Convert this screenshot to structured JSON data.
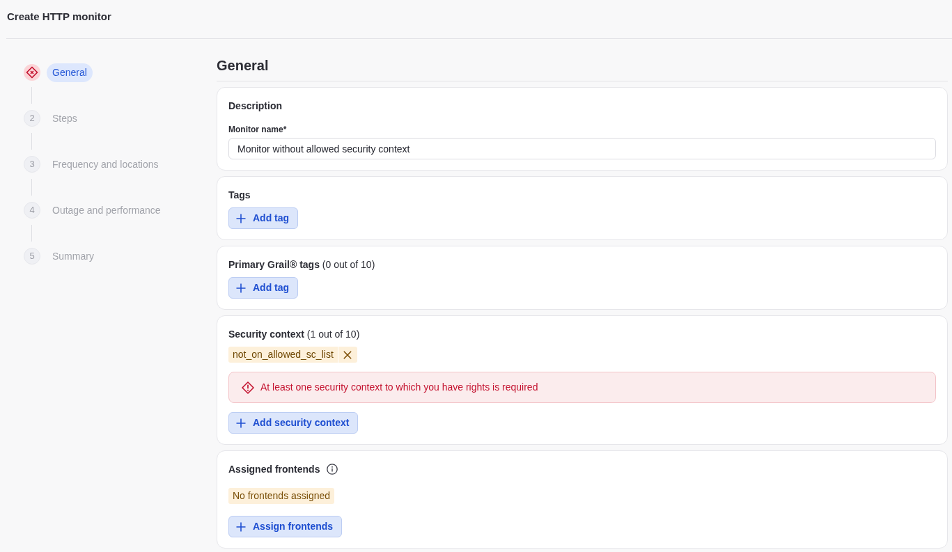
{
  "header": {
    "title": "Create HTTP monitor"
  },
  "stepper": {
    "steps": [
      {
        "label": "General",
        "selected": true,
        "error": true
      },
      {
        "number": "2",
        "label": "Steps",
        "selected": false,
        "error": false
      },
      {
        "number": "3",
        "label": "Frequency and locations",
        "selected": false,
        "error": false
      },
      {
        "number": "4",
        "label": "Outage and performance",
        "selected": false,
        "error": false
      },
      {
        "number": "5",
        "label": "Summary",
        "selected": false,
        "error": false
      }
    ]
  },
  "main": {
    "heading": "General",
    "sections": [
      {
        "title": "Description",
        "field": {
          "label": "Monitor name*",
          "value": "Monitor without allowed security context"
        }
      },
      {
        "title": "Tags",
        "button": "Add tag"
      },
      {
        "title": "Primary Grail® tags",
        "count": "(0 out of 10)",
        "button": "Add tag"
      },
      {
        "title": "Security context",
        "count": "(1 out of 10)",
        "chips": [
          {
            "label": "not_on_allowed_sc_list",
            "removable": true
          }
        ],
        "error": "At least one security context to which you have rights is required",
        "button": "Add security context"
      },
      {
        "title": "Assigned frontends",
        "info": true,
        "notice": "No frontends assigned",
        "button": "Assign frontends"
      }
    ]
  }
}
